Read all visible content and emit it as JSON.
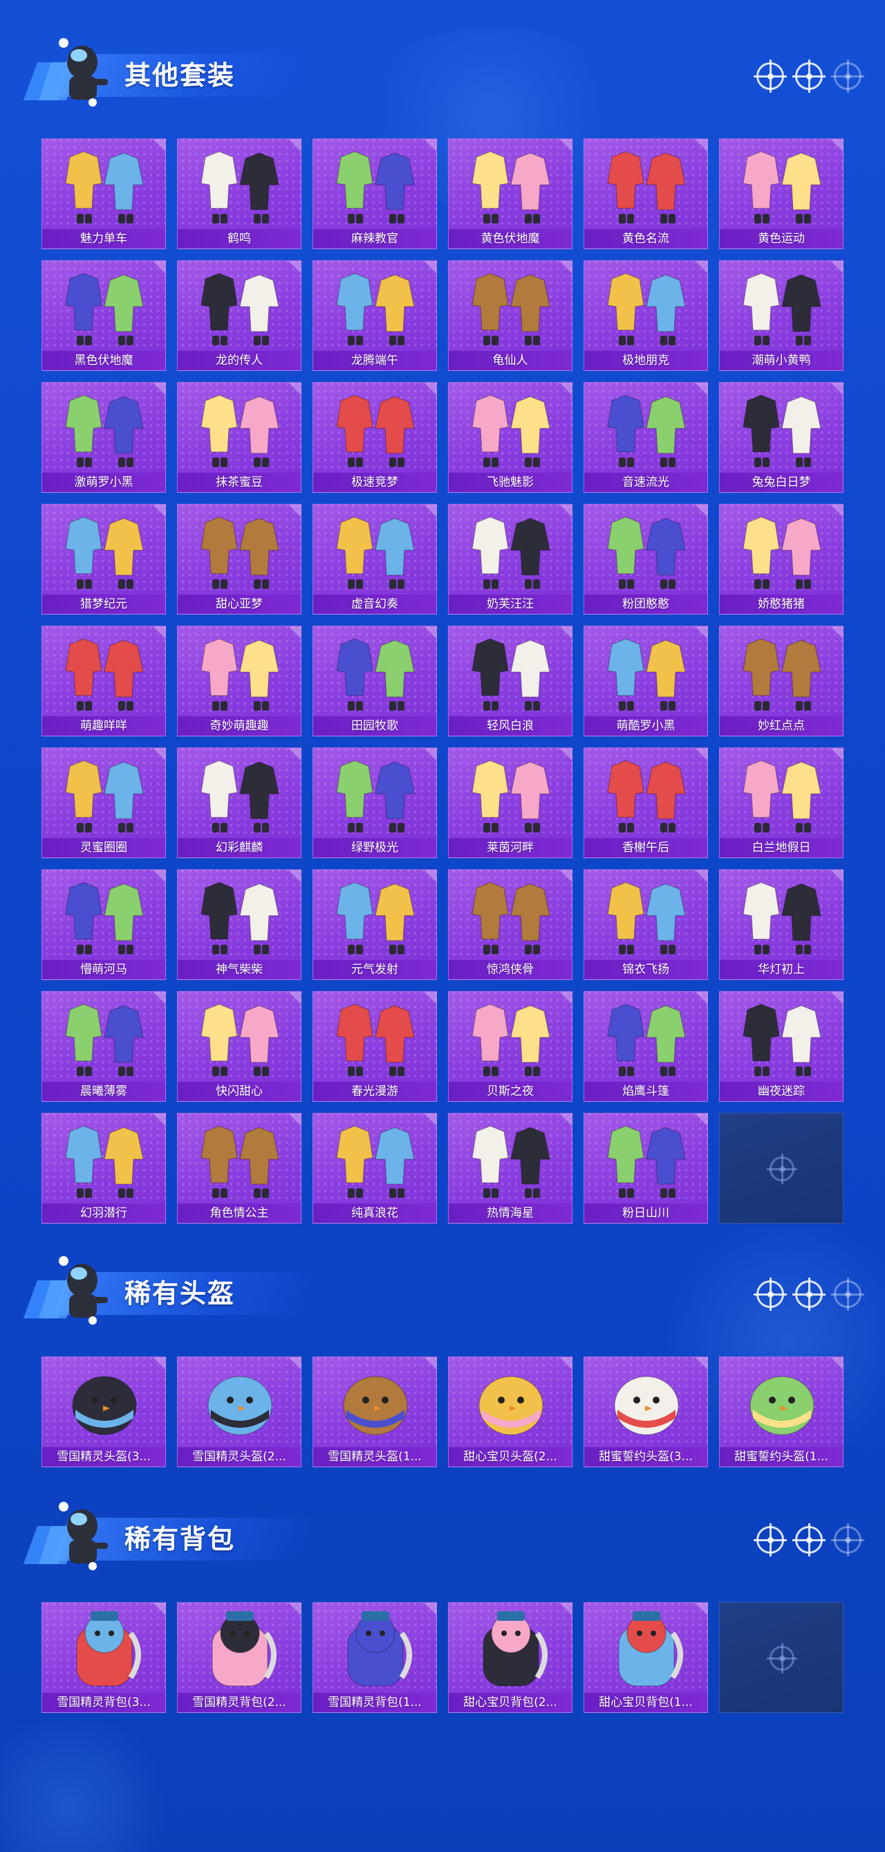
{
  "colors": {
    "background": "#1450d6",
    "card": "#8c3fe0",
    "label_bar": "#6a1fc4",
    "empty_card": "#1f3e86"
  },
  "sections": [
    {
      "title": "其他套装",
      "items": [
        "魅力单车",
        "鹤鸣",
        "麻辣教官",
        "黄色伏地魔",
        "黄色名流",
        "黄色运动",
        "黑色伏地魔",
        "龙的传人",
        "龙腾端午",
        "龟仙人",
        "极地朋克",
        "潮萌小黄鸭",
        "激萌罗小黑",
        "抹茶蜜豆",
        "极速竞梦",
        "飞驰魅影",
        "音速流光",
        "兔兔白日梦",
        "猎梦纪元",
        "甜心亚梦",
        "虚音幻奏",
        "奶芙汪汪",
        "粉团憨憨",
        "娇憨猪猪",
        "萌趣咩咩",
        "奇妙萌趣趣",
        "田园牧歌",
        "轻风白浪",
        "萌酷罗小黑",
        "妙红点点",
        "灵蜜圈圈",
        "幻彩麒麟",
        "绿野极光",
        "莱茵河畔",
        "香榭午后",
        "白兰地假日",
        "懵萌河马",
        "神气柴柴",
        "元气发射",
        "惊鸿侠骨",
        "锦衣飞扬",
        "华灯初上",
        "晨曦薄雾",
        "快闪甜心",
        "春光漫游",
        "贝斯之夜",
        "焰鹰斗篷",
        "幽夜迷踪",
        "幻羽潜行",
        "角色情公主",
        "纯真浪花",
        "热情海星",
        "粉日山川"
      ],
      "empty_slots": 1
    },
    {
      "title": "稀有头盔",
      "items": [
        "雪国精灵头盔(3...",
        "雪国精灵头盔(2...",
        "雪国精灵头盔(1...",
        "甜心宝贝头盔(2...",
        "甜蜜誓约头盔(3...",
        "甜蜜誓约头盔(1..."
      ],
      "empty_slots": 0
    },
    {
      "title": "稀有背包",
      "items": [
        "雪国精灵背包(3...",
        "雪国精灵背包(2...",
        "雪国精灵背包(1...",
        "甜心宝贝背包(2...",
        "甜心宝贝背包(1..."
      ],
      "empty_slots": 1
    }
  ]
}
